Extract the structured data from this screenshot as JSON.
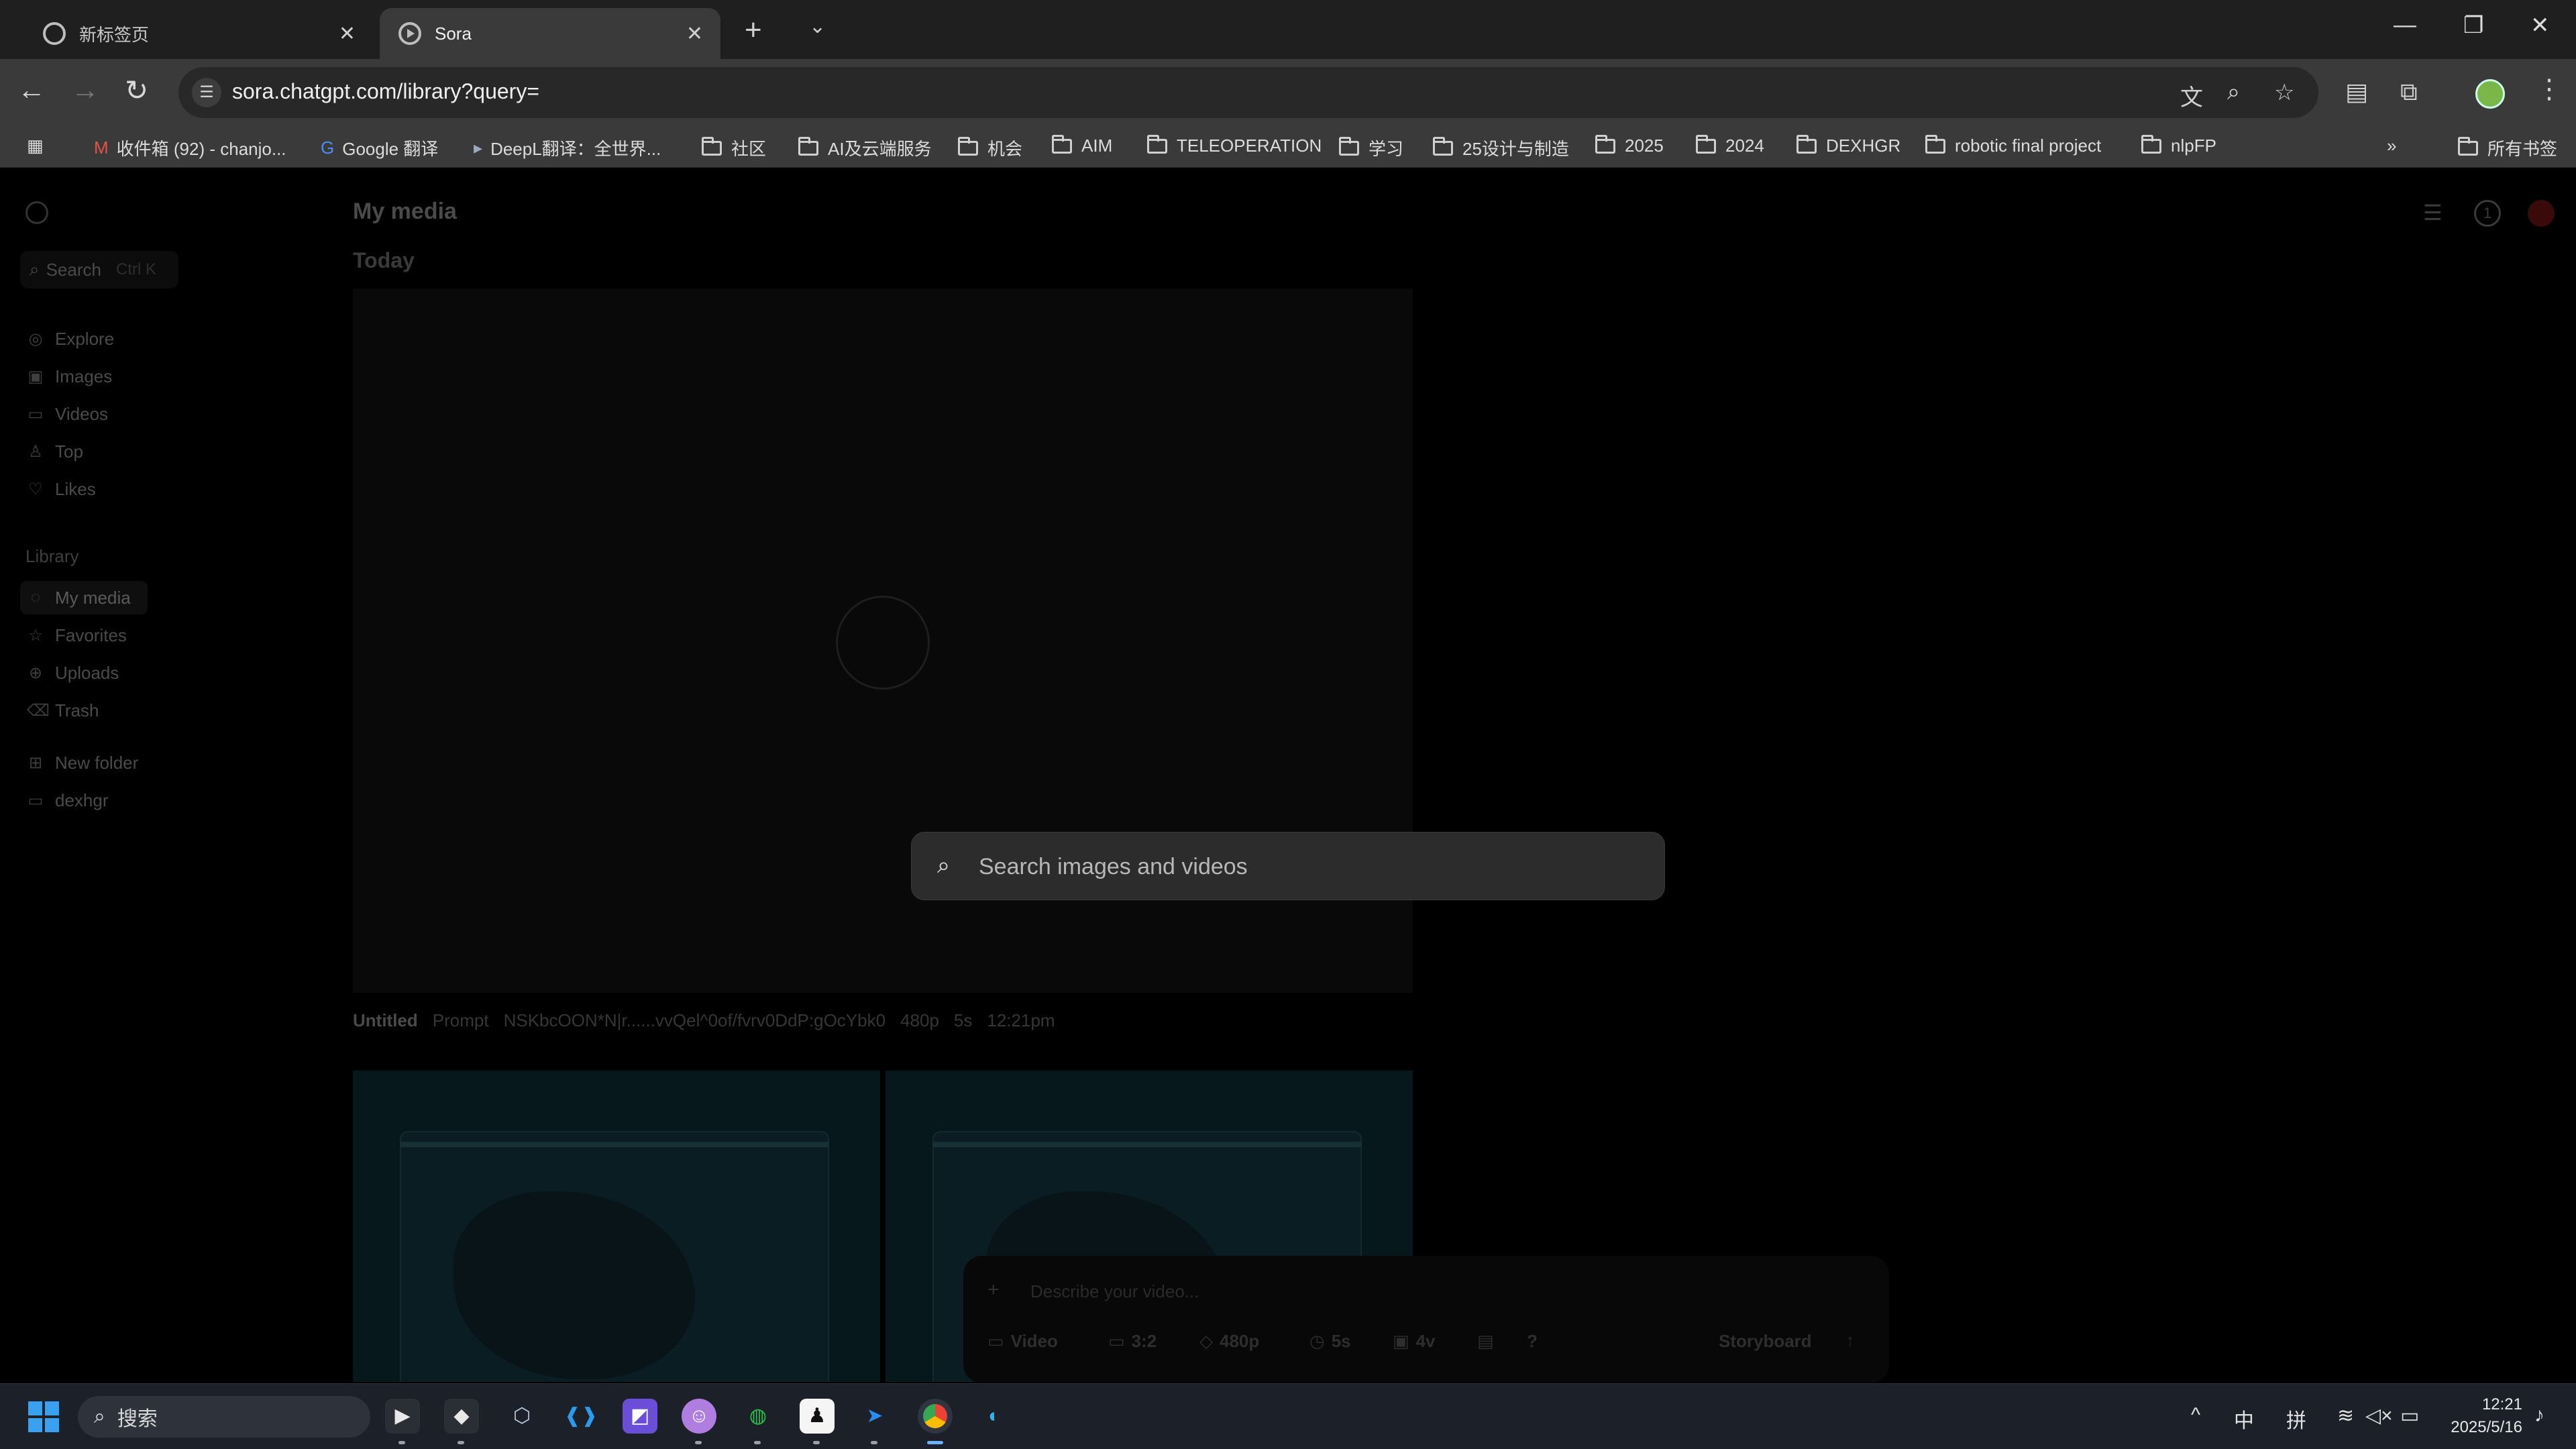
{
  "browser": {
    "tabs": [
      {
        "title": "新标签页",
        "icon": "chrome-icon",
        "active": false
      },
      {
        "title": "Sora",
        "icon": "sora-play-icon",
        "active": true
      }
    ],
    "url": "sora.chatgpt.com/library?query=",
    "bookmarks": [
      {
        "label": "收件箱 (92) - chanjo...",
        "icon": "gmail-icon"
      },
      {
        "label": "Google 翻译",
        "icon": "google-translate-icon"
      },
      {
        "label": "DeepL翻译：全世界...",
        "icon": "deepl-icon"
      },
      {
        "label": "社区",
        "icon": "folder-icon"
      },
      {
        "label": "AI及云端服务",
        "icon": "folder-icon"
      },
      {
        "label": "机会",
        "icon": "folder-icon"
      },
      {
        "label": "AIM",
        "icon": "folder-icon"
      },
      {
        "label": "TELEOPERATION",
        "icon": "folder-icon"
      },
      {
        "label": "学习",
        "icon": "folder-icon"
      },
      {
        "label": "25设计与制造",
        "icon": "folder-icon"
      },
      {
        "label": "2025",
        "icon": "folder-icon"
      },
      {
        "label": "2024",
        "icon": "folder-icon"
      },
      {
        "label": "DEXHGR",
        "icon": "folder-icon"
      },
      {
        "label": "robotic final project",
        "icon": "folder-icon"
      },
      {
        "label": "nlpFP",
        "icon": "folder-icon"
      }
    ],
    "all_bookmarks": "所有书签"
  },
  "sidebar": {
    "search_label": "Search",
    "search_shortcut": "Ctrl K",
    "nav": [
      {
        "label": "Explore",
        "icon": "compass-icon"
      },
      {
        "label": "Images",
        "icon": "image-icon"
      },
      {
        "label": "Videos",
        "icon": "video-icon"
      },
      {
        "label": "Top",
        "icon": "trophy-icon"
      },
      {
        "label": "Likes",
        "icon": "heart-icon"
      }
    ],
    "library_heading": "Library",
    "library": [
      {
        "label": "My media",
        "icon": "media-icon",
        "selected": true
      },
      {
        "label": "Favorites",
        "icon": "star-icon"
      },
      {
        "label": "Uploads",
        "icon": "upload-icon"
      },
      {
        "label": "Trash",
        "icon": "trash-icon"
      }
    ],
    "folders": [
      {
        "label": "New folder",
        "icon": "new-folder-icon"
      },
      {
        "label": "dexhgr",
        "icon": "folder-icon"
      }
    ]
  },
  "main": {
    "title": "My media",
    "section": "Today",
    "video": {
      "title": "Untitled",
      "prompt_label": "Prompt",
      "prompt": "NSKbcOON*N|r......vvQel^0of/fvrv0DdP:gOcYbk0",
      "resolution": "480p",
      "duration": "5s",
      "time": "12:21pm"
    },
    "top_right_badge": "1"
  },
  "composer": {
    "placeholder": "Describe your video...",
    "chips": [
      {
        "label": "Video",
        "icon": "video-icon"
      },
      {
        "label": "3:2",
        "icon": "aspect-ratio-icon"
      },
      {
        "label": "480p",
        "icon": "resolution-icon"
      },
      {
        "label": "5s",
        "icon": "clock-icon"
      },
      {
        "label": "4v",
        "icon": "variations-icon"
      }
    ],
    "help": "?",
    "storyboard": "Storyboard"
  },
  "search_modal": {
    "placeholder": "Search images and videos"
  },
  "taskbar": {
    "search_placeholder": "搜索",
    "ime_lang": "中",
    "ime_mode": "拼",
    "time": "12:21",
    "date": "2025/5/16"
  },
  "colors": {
    "accent_search_bg": "#2c2c2c",
    "page_bg": "#000000",
    "chrome_bg": "#3a3a3a"
  }
}
